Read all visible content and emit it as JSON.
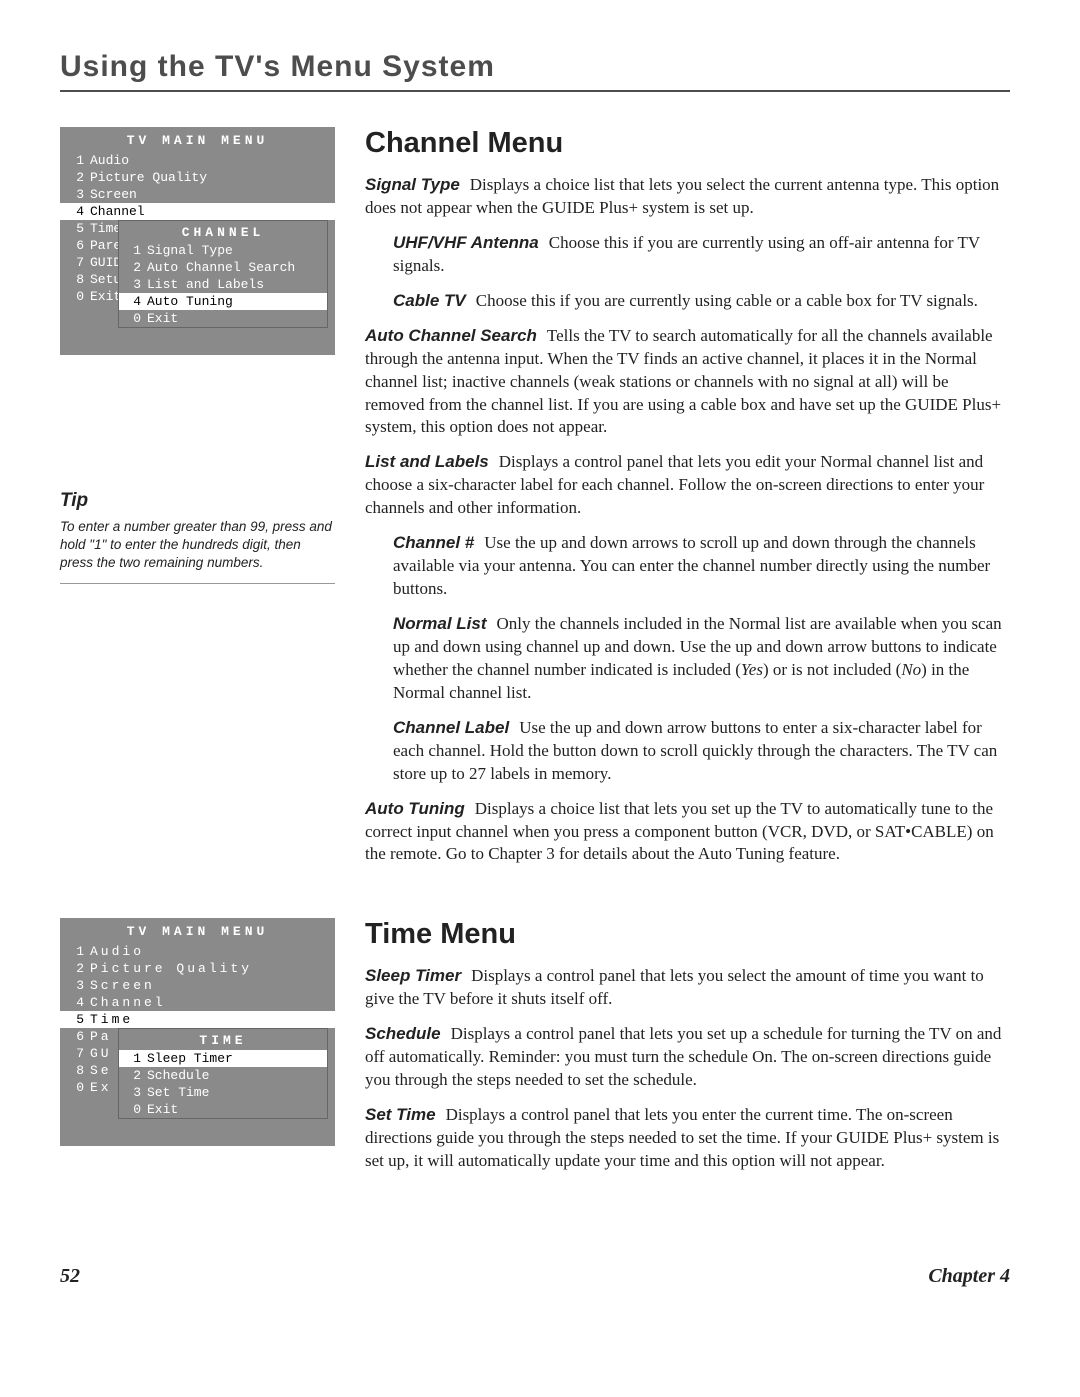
{
  "page_title": "Using the TV's Menu System",
  "menu1": {
    "title": "TV MAIN MENU",
    "rows": [
      {
        "n": "1",
        "label": "Audio"
      },
      {
        "n": "2",
        "label": "Picture Quality"
      },
      {
        "n": "3",
        "label": "Screen"
      },
      {
        "n": "4",
        "label": "Channel",
        "selected": true
      },
      {
        "n": "5",
        "label": "Time"
      },
      {
        "n": "6",
        "label": "Pare"
      },
      {
        "n": "7",
        "label": "GUID"
      },
      {
        "n": "8",
        "label": "Setu"
      },
      {
        "n": "0",
        "label": "Exit"
      }
    ],
    "submenu": {
      "title": "CHANNEL",
      "rows": [
        {
          "n": "1",
          "label": "Signal Type"
        },
        {
          "n": "2",
          "label": "Auto Channel Search"
        },
        {
          "n": "3",
          "label": "List and Labels"
        },
        {
          "n": "4",
          "label": "Auto Tuning",
          "selected": true
        },
        {
          "n": "0",
          "label": "Exit"
        }
      ]
    }
  },
  "tip": {
    "head": "Tip",
    "text": "To enter a number greater than 99, press and hold \"1\" to enter the hundreds digit, then press the two remaining numbers."
  },
  "channel": {
    "heading": "Channel Menu",
    "signal_type_term": "Signal Type",
    "signal_type_body": "Displays a choice list that lets you select the current antenna type. This option does not appear when the GUIDE Plus+ system is set up.",
    "uhf_term": "UHF/VHF Antenna",
    "uhf_body": "Choose this if you are currently using an off-air antenna for TV signals.",
    "cable_term": "Cable TV",
    "cable_body": "Choose this if you are currently using cable or a cable box for TV signals.",
    "acs_term": "Auto Channel Search",
    "acs_body": "Tells the TV to search automatically for all the channels available through the antenna input. When the TV finds an active channel, it places it in the Normal channel list; inactive channels (weak stations or channels with no signal at all) will be removed from the channel list. If you are using a cable box and have set up the GUIDE Plus+ system, this option does not appear.",
    "list_term": "List and Labels",
    "list_body": "Displays a control panel that lets you edit your Normal channel list and choose a six-character label for each channel. Follow the on-screen directions to enter your channels and other information.",
    "chnum_term": "Channel #",
    "chnum_body": "Use the up and down arrows to scroll up and down through the channels available via your antenna. You can enter the channel number directly using the number buttons.",
    "normal_term": "Normal List",
    "normal_body_a": "Only the channels included in the Normal list are available when you scan up and down using channel up and down. Use the up and down arrow buttons to indicate whether the channel number indicated is included (",
    "normal_yes": "Yes",
    "normal_body_b": ") or is not included (",
    "normal_no": "No",
    "normal_body_c": ") in the Normal channel list.",
    "label_term": "Channel Label",
    "label_body": "Use the up and down arrow buttons to enter a six-character label for each channel. Hold the button down to scroll quickly through the characters. The TV can store up to 27 labels in memory.",
    "auto_term": "Auto Tuning",
    "auto_body": "Displays a choice list that lets you set up the TV to automatically tune to the correct input channel when you press a component button (VCR, DVD, or SAT•CABLE) on the remote. Go to Chapter 3 for details about the Auto Tuning feature."
  },
  "menu2": {
    "title": "TV MAIN MENU",
    "rows": [
      {
        "n": "1",
        "label": "Audio"
      },
      {
        "n": "2",
        "label": "Picture Quality"
      },
      {
        "n": "3",
        "label": "Screen"
      },
      {
        "n": "4",
        "label": "Channel"
      },
      {
        "n": "5",
        "label": "Time",
        "selected": true
      },
      {
        "n": "6",
        "label": "Pa"
      },
      {
        "n": "7",
        "label": "GU"
      },
      {
        "n": "8",
        "label": "Se"
      },
      {
        "n": "0",
        "label": "Ex"
      }
    ],
    "submenu": {
      "title": "TIME",
      "rows": [
        {
          "n": "1",
          "label": "Sleep Timer",
          "selected": true
        },
        {
          "n": "2",
          "label": "Schedule"
        },
        {
          "n": "3",
          "label": "Set Time"
        },
        {
          "n": "0",
          "label": "Exit"
        }
      ]
    }
  },
  "time": {
    "heading": "Time Menu",
    "sleep_term": "Sleep Timer",
    "sleep_body": "Displays a control panel that lets you select the amount of time you want to give the TV before it shuts itself off.",
    "sched_term": "Schedule",
    "sched_body": "Displays a control panel that lets you set up a schedule for turning the TV on and off automatically. Reminder: you must turn the schedule On. The on-screen directions guide you through the steps needed to set the schedule.",
    "set_term": "Set Time",
    "set_body": "Displays a control panel that lets you enter the current time. The on-screen directions guide you through the steps needed to set the time. If your GUIDE Plus+ system is set up, it will automatically update your time and this option will not appear."
  },
  "footer": {
    "page": "52",
    "chapter": "Chapter 4"
  }
}
